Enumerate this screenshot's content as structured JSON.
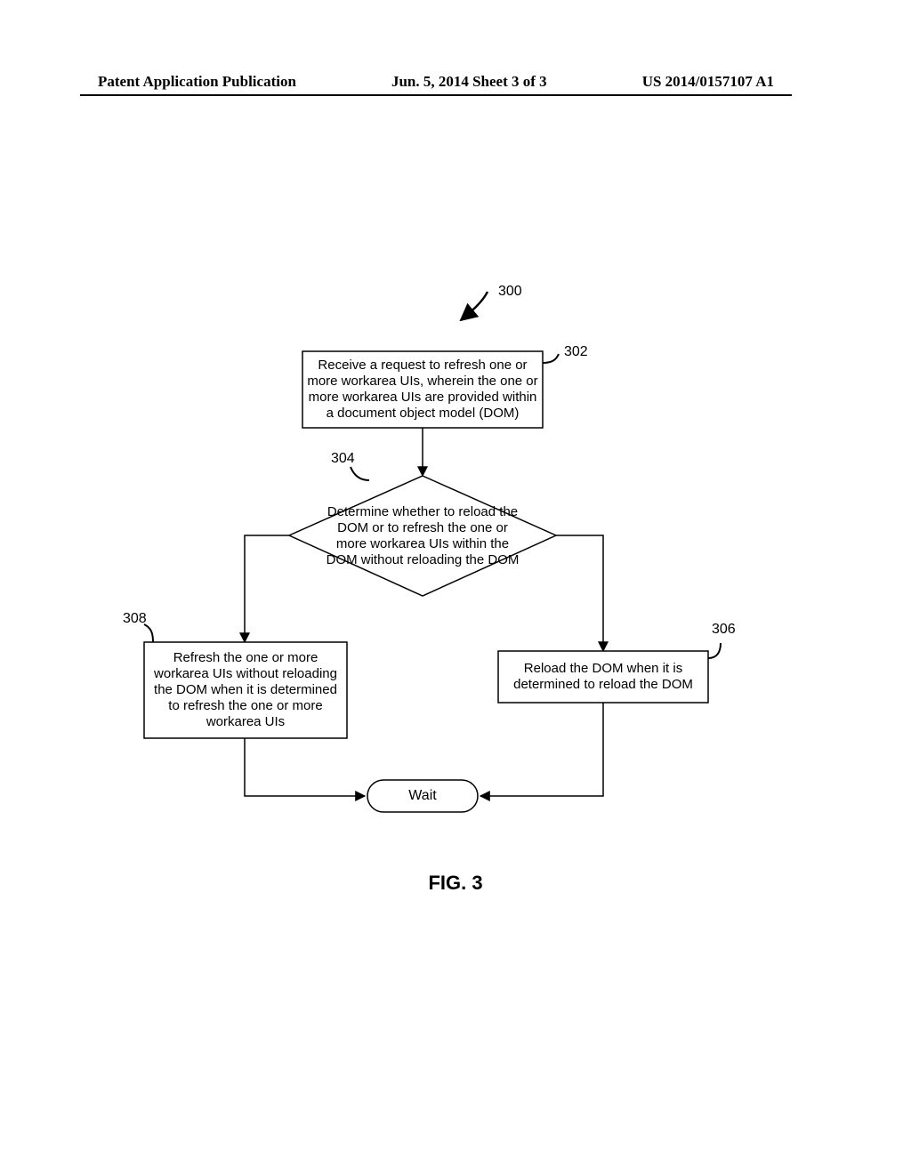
{
  "header": {
    "left": "Patent Application Publication",
    "center": "Jun. 5, 2014  Sheet 3 of 3",
    "right": "US 2014/0157107 A1"
  },
  "refs": {
    "r300": "300",
    "r302": "302",
    "r304": "304",
    "r306": "306",
    "r308": "308"
  },
  "boxes": {
    "b302": "Receive a request to refresh one or more workarea UIs, wherein the one or more workarea UIs are provided within a document object model (DOM)",
    "d304": "Determine whether to reload the DOM or to refresh the one or more workarea UIs within the DOM without reloading the DOM",
    "b306": "Reload the DOM when it is determined to reload the DOM",
    "b308": "Refresh the one or more workarea UIs without reloading the DOM when it is determined to refresh the one or more workarea UIs",
    "wait": "Wait"
  },
  "caption": "FIG. 3"
}
